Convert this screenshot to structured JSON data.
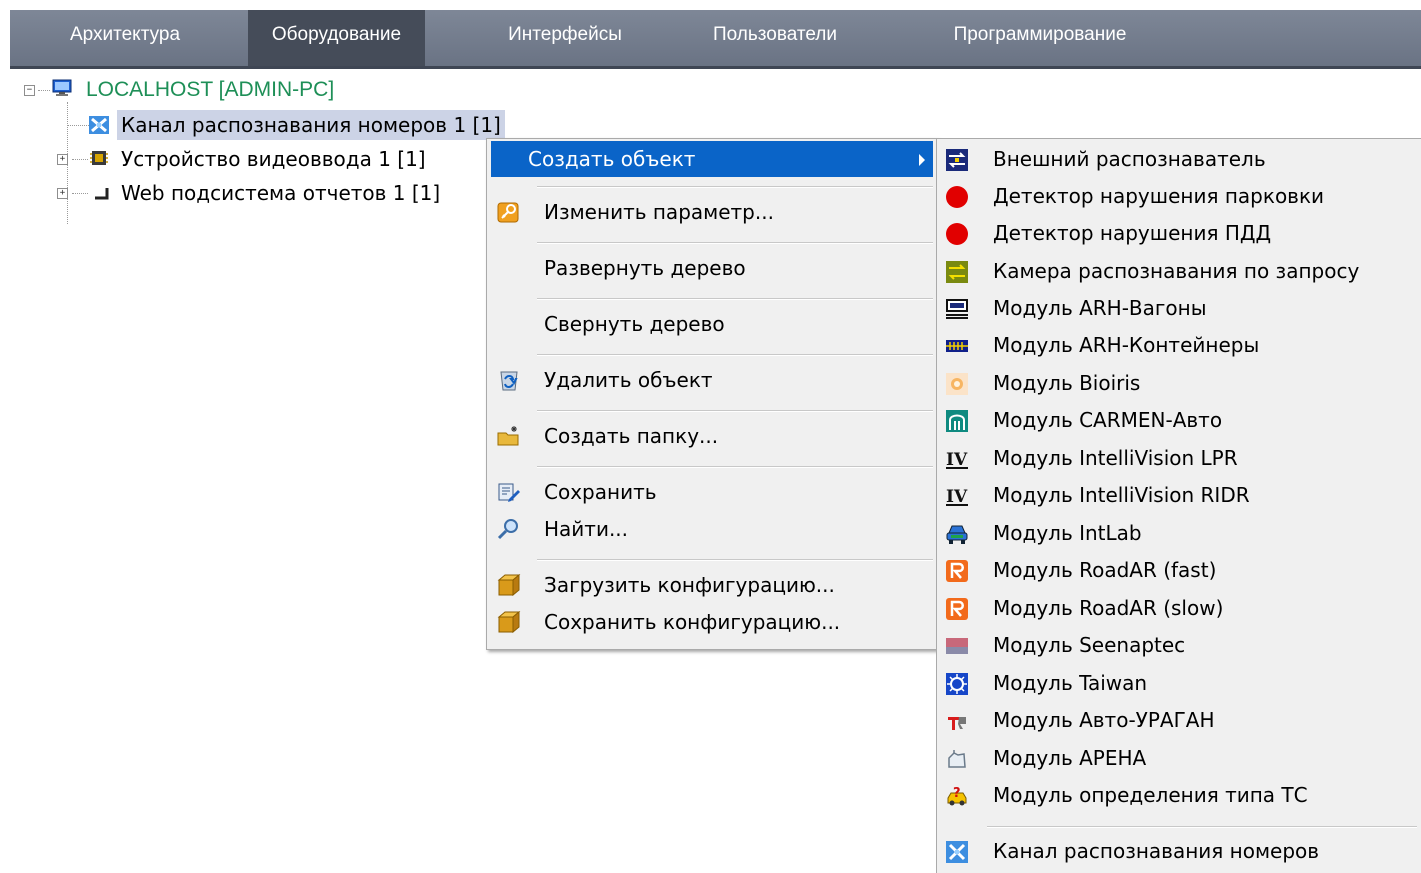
{
  "tabs": [
    {
      "label": "Архитектура",
      "active": false
    },
    {
      "label": "Оборудование",
      "active": true
    },
    {
      "label": "Интерфейсы",
      "active": false
    },
    {
      "label": "Пользователи",
      "active": false
    },
    {
      "label": "Программирование",
      "active": false
    }
  ],
  "tree": {
    "root": {
      "label": "LOCALHOST [ADMIN-PC]",
      "expander": "−"
    },
    "children": [
      {
        "label": "Канал распознавания номеров 1 [1]",
        "selected": true
      },
      {
        "label": "Устройство видеоввода 1 [1]",
        "expander": "+"
      },
      {
        "label": "Web подсистема отчетов 1 [1]",
        "expander": "+"
      }
    ]
  },
  "context_menu": {
    "items": [
      {
        "label": "Создать объект",
        "highlighted": true,
        "has_submenu": true
      },
      {
        "label": "Изменить параметр...",
        "icon": "key-icon"
      },
      {
        "label": "Развернуть дерево"
      },
      {
        "label": "Свернуть дерево"
      },
      {
        "label": "Удалить объект",
        "icon": "recycle-bin-icon"
      },
      {
        "label": "Создать папку...",
        "icon": "new-folder-icon"
      },
      {
        "label": "Сохранить",
        "icon": "save-edit-icon"
      },
      {
        "label": "Найти...",
        "icon": "magnifier-icon"
      },
      {
        "label": "Загрузить конфигурацию...",
        "icon": "load-config-icon"
      },
      {
        "label": "Сохранить конфигурацию...",
        "icon": "save-config-icon"
      }
    ]
  },
  "submenu": {
    "items": [
      {
        "label": "Внешний распознаватель",
        "icon": "external-recognizer-icon"
      },
      {
        "label": "Детектор нарушения парковки",
        "icon": "red-dot-icon"
      },
      {
        "label": "Детектор нарушения ПДД",
        "icon": "red-dot-icon"
      },
      {
        "label": "Камера распознавания по запросу",
        "icon": "request-camera-icon"
      },
      {
        "label": "Модуль ARH-Вагоны",
        "icon": "wagon-icon"
      },
      {
        "label": "Модуль ARH-Контейнеры",
        "icon": "container-icon"
      },
      {
        "label": "Модуль Bioiris",
        "icon": "bioiris-icon"
      },
      {
        "label": "Модуль CARMEN-Авто",
        "icon": "carmen-icon"
      },
      {
        "label": "Модуль IntelliVision LPR",
        "icon": "intellivision-icon"
      },
      {
        "label": "Модуль IntelliVision RIDR",
        "icon": "intellivision-icon"
      },
      {
        "label": "Модуль IntLab",
        "icon": "intlab-car-icon"
      },
      {
        "label": "Модуль RoadAR (fast)",
        "icon": "roadar-icon"
      },
      {
        "label": "Модуль RoadAR (slow)",
        "icon": "roadar-icon"
      },
      {
        "label": "Модуль Seenaptec",
        "icon": "seenaptec-icon"
      },
      {
        "label": "Модуль Taiwan",
        "icon": "taiwan-icon"
      },
      {
        "label": "Модуль Авто-УРАГАН",
        "icon": "uragan-icon"
      },
      {
        "label": "Модуль АРЕНА",
        "icon": "arena-icon"
      },
      {
        "label": "Модуль определения типа ТС",
        "icon": "vehicle-type-icon"
      },
      {
        "label": "Канал распознавания номеров",
        "icon": "lpr-channel-icon"
      }
    ]
  },
  "colors": {
    "tabbar": "#737c8d",
    "active_tab": "#454c59",
    "root_text": "#1e8f57",
    "selection": "#ccd3e6",
    "menu_highlight": "#0a64c8",
    "menu_bg": "#f0f0f0"
  }
}
